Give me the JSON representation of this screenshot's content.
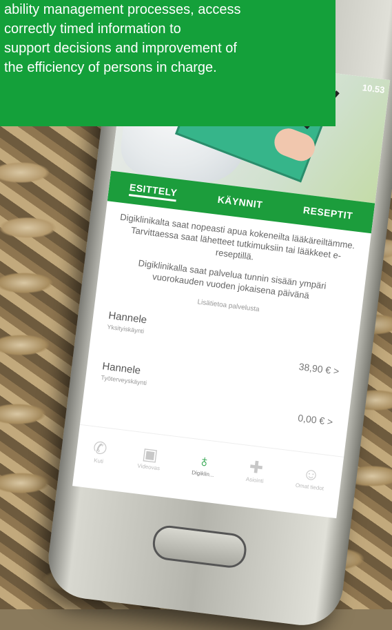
{
  "overlay": {
    "lines": [
      "ability management processes, access",
      "correctly timed information to",
      "support decisions and improvement of",
      "the efficiency of persons in charge."
    ]
  },
  "screen": {
    "status_time": "10.53",
    "tabs": [
      {
        "label": "ESITTELY",
        "active": true
      },
      {
        "label": "KÄYNNIT",
        "active": false
      },
      {
        "label": "RESEPTIT",
        "active": false
      }
    ],
    "paragraph1": "Digiklinikalta saat nopeasti apua kokeneilta lääkäreiltämme. Tarvittaessa saat lähetteet tutkimuksiin tai lääkkeet e-reseptillä.",
    "paragraph2": "Digiklinikalla saat palvelua tunnin sisään ympäri vuorokauden vuoden jokaisena päivänä",
    "more_link": "Lisätietoa palvelusta",
    "visits": [
      {
        "name": "Hannele",
        "type": "Yksityiskäynti",
        "price": "38,90 €  >"
      },
      {
        "name": "Hannele",
        "type": "Työterveyskäynti",
        "price": "0,00 €  >"
      }
    ],
    "nav": [
      {
        "icon": "phone-icon",
        "glyph": "✆",
        "label": "Kuti",
        "active": false
      },
      {
        "icon": "video-icon",
        "glyph": "▣",
        "label": "Videovas",
        "active": false
      },
      {
        "icon": "stethoscope-icon",
        "glyph": "♁",
        "label": "Digiklin...",
        "active": true
      },
      {
        "icon": "plus-cross-icon",
        "glyph": "✚",
        "label": "Asiointi",
        "active": false
      },
      {
        "icon": "person-icon",
        "glyph": "☺",
        "label": "Omat tiedot",
        "active": false
      }
    ]
  },
  "colors": {
    "brand_green": "#1c9d3c",
    "overlay_green": "#14a03a"
  }
}
